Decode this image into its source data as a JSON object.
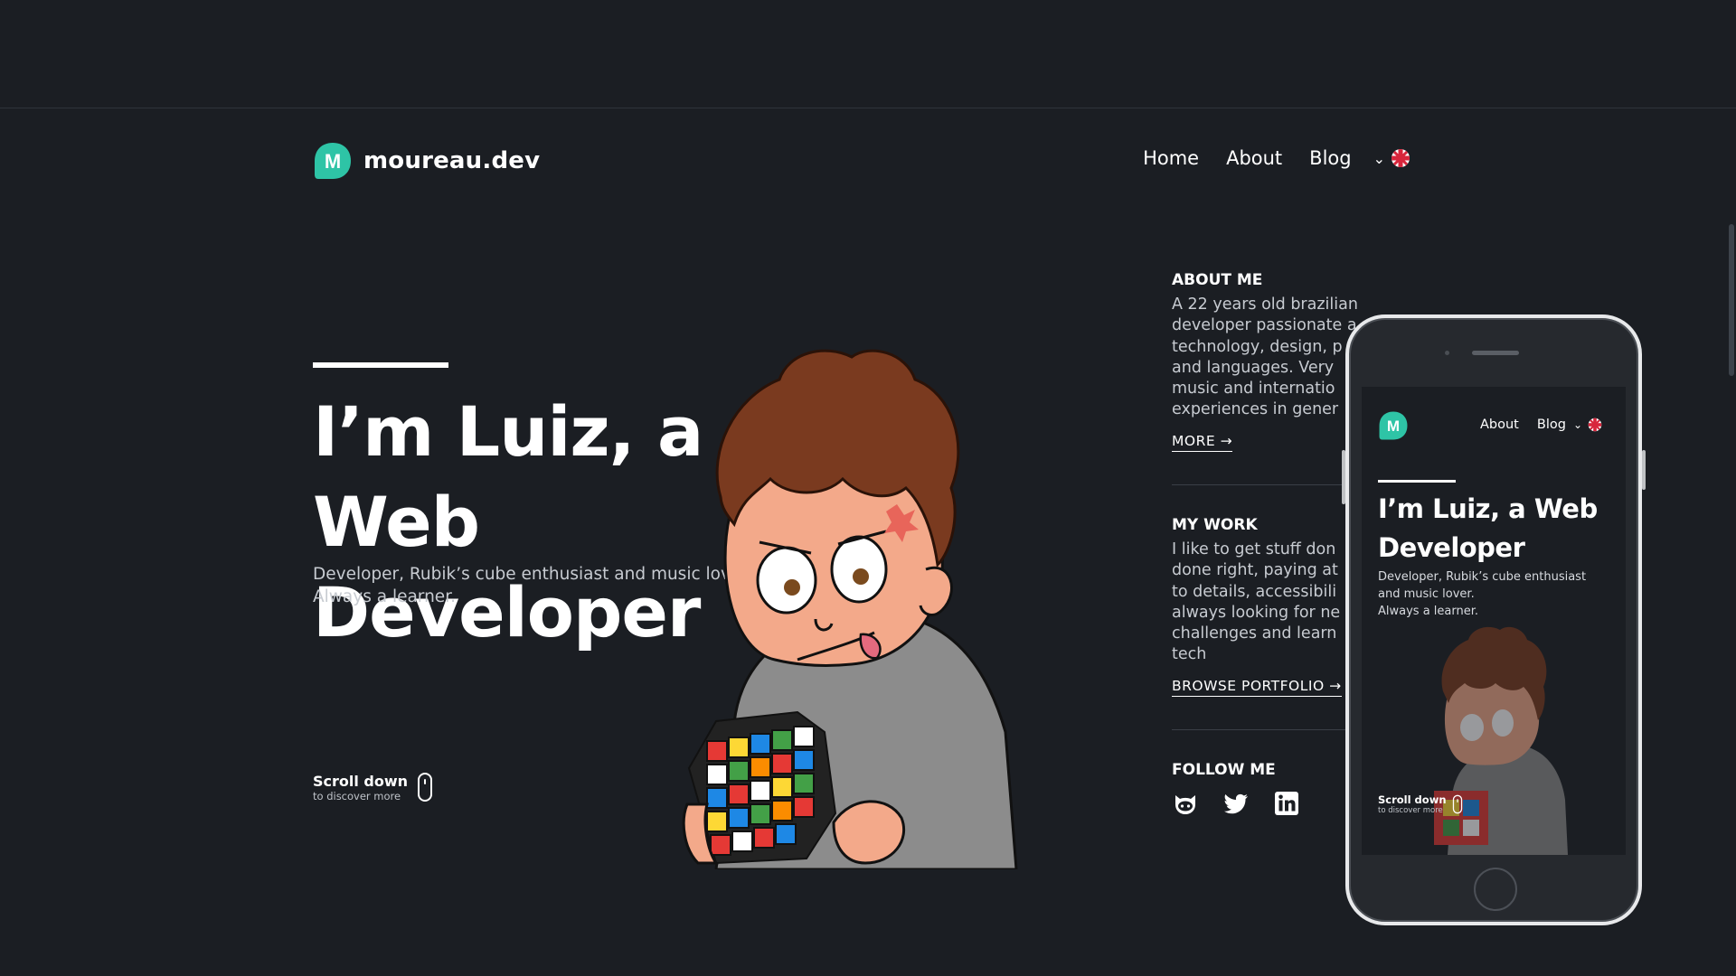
{
  "header": {
    "site_name": "moureau.dev",
    "logo_letter": "M",
    "brand_color": "#2ec4a6",
    "nav": [
      {
        "label": "Home"
      },
      {
        "label": "About"
      },
      {
        "label": "Blog"
      }
    ],
    "language_icon": "uk-flag-icon"
  },
  "hero": {
    "title": "I’m Luiz, a Web Developer",
    "subtitle_line1": "Developer, Rubik’s cube enthusiast and music lover.",
    "subtitle_line2": "Always a learner.",
    "scroll_title": "Scroll down",
    "scroll_subtitle": "to discover more"
  },
  "sections": {
    "about": {
      "title": "ABOUT ME",
      "lines": [
        "A 22 years old brazilian",
        "developer passionate a",
        "technology, design, p",
        "and languages. Very",
        "music and internatio",
        "experiences in gener"
      ],
      "link": "MORE →"
    },
    "work": {
      "title": "MY WORK",
      "lines": [
        "I like to get stuff don",
        "done right, paying at",
        "to details, accessibili",
        "always looking for ne",
        "challenges and learn",
        "tech"
      ],
      "link": "BROWSE PORTFOLIO →"
    },
    "follow": {
      "title": "FOLLOW ME",
      "icons": [
        "github-icon",
        "twitter-icon",
        "linkedin-icon"
      ]
    }
  },
  "phone_preview": {
    "logo_letter": "M",
    "nav": [
      {
        "label": "About"
      },
      {
        "label": "Blog"
      }
    ],
    "title": "I’m Luiz, a Web Developer",
    "subtitle_lines": [
      "Developer, Rubik’s cube enthusiast",
      "and music lover.",
      "Always a learner."
    ],
    "scroll_title": "Scroll down",
    "scroll_subtitle": "to discover more"
  }
}
